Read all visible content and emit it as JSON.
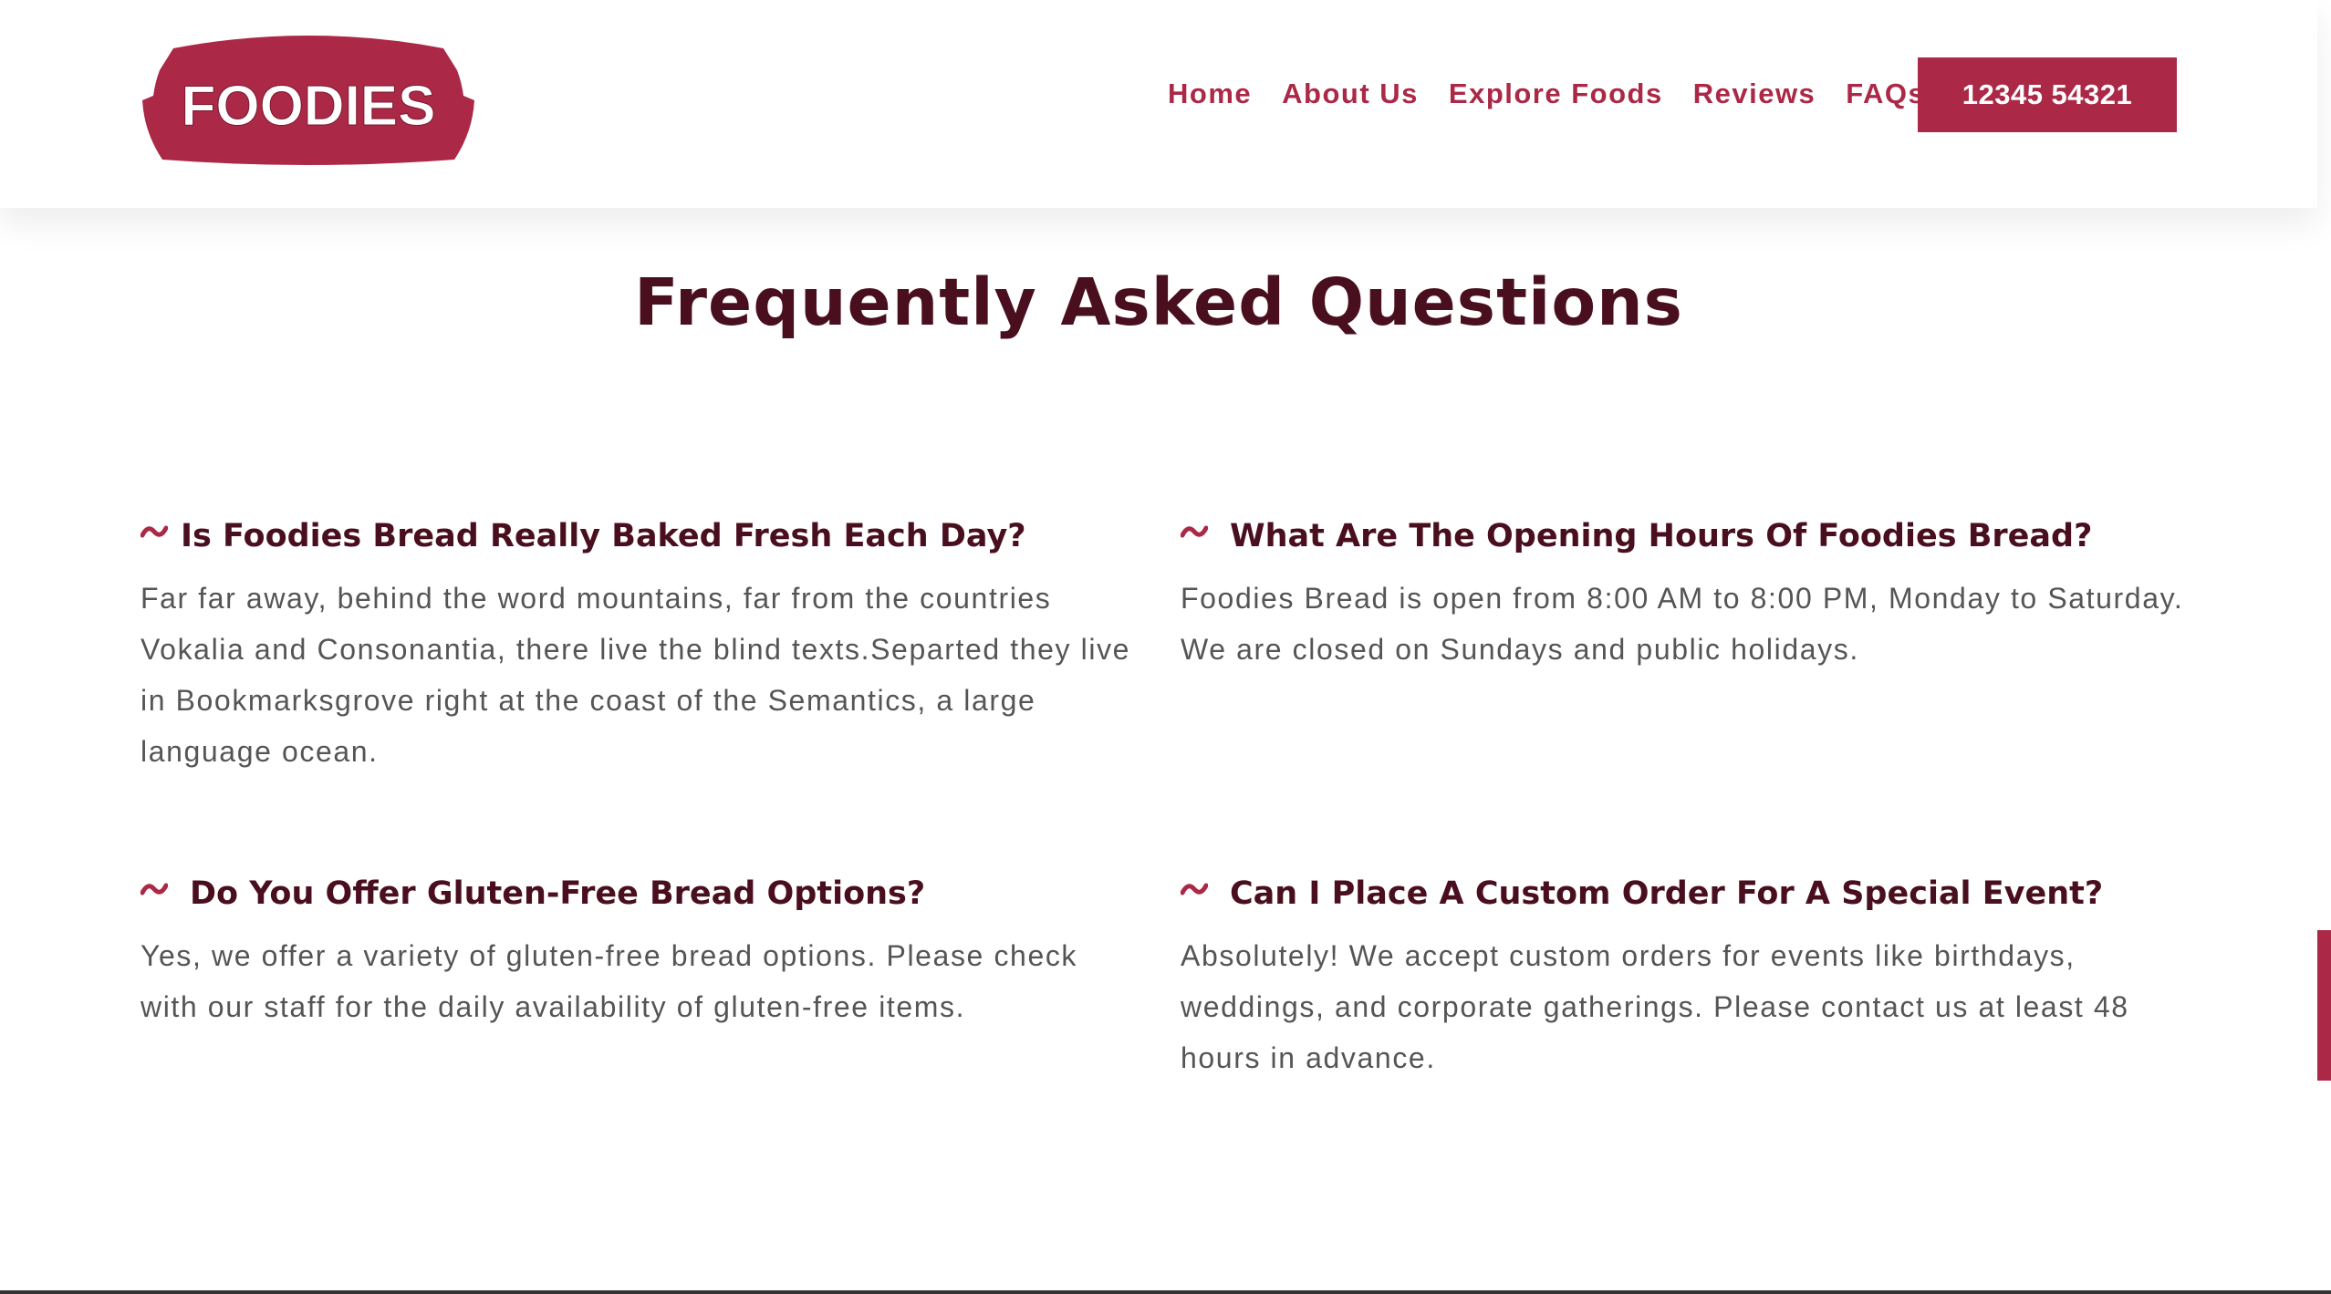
{
  "header": {
    "logo_text": "FOODIES",
    "nav": [
      {
        "label": "Home"
      },
      {
        "label": "About Us"
      },
      {
        "label": "Explore Foods"
      },
      {
        "label": "Reviews"
      },
      {
        "label": "FAQs"
      }
    ],
    "phone": "12345 54321"
  },
  "main": {
    "title": "Frequently Asked Questions",
    "faqs": [
      {
        "icon": "tilde-icon",
        "question": "Is Foodies Bread Really Baked Fresh Each Day?",
        "answer": "Far far away, behind the word mountains, far from the countries Vokalia and Consonantia, there live the blind texts.Separted they live in Bookmarksgrove right at the coast of the Semantics, a large language ocean."
      },
      {
        "icon": "tilde-icon",
        "question": "What Are The Opening Hours Of Foodies Bread?",
        "answer": "Foodies Bread is open from 8:00 AM to 8:00 PM, Monday to Saturday. We are closed on Sundays and public holidays."
      },
      {
        "icon": "tilde-icon",
        "question": "Do You Offer Gluten-Free Bread Options?",
        "answer": "Yes, we offer a variety of gluten-free bread options. Please check with our staff for the daily availability of gluten-free items."
      },
      {
        "icon": "tilde-icon",
        "question": "Can I Place A Custom Order For A Special Event?",
        "answer": "Absolutely! We accept custom orders for events like birthdays, weddings, and corporate gatherings. Please contact us at least 48 hours in advance."
      }
    ]
  },
  "colors": {
    "brand": "#ab2846",
    "heading": "#4a0f1f",
    "body_text": "#555555"
  }
}
